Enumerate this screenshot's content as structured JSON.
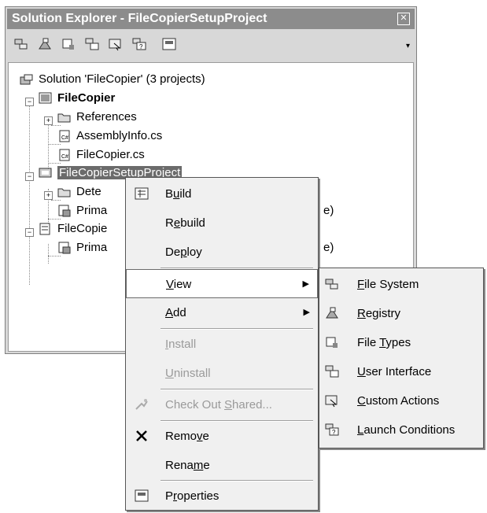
{
  "window": {
    "title": "Solution Explorer - FileCopierSetupProject",
    "close_glyph": "✕"
  },
  "toolbar": {
    "buttons": [
      "file-system-icon",
      "registry-icon",
      "file-types-icon",
      "user-interface-icon",
      "custom-actions-icon",
      "launch-conditions-icon",
      "properties-icon"
    ],
    "dropdown_glyph": "▾"
  },
  "tree": {
    "solution": "Solution 'FileCopier' (3 projects)",
    "project1": "FileCopier",
    "references": "References",
    "assemblyinfo": "AssemblyInfo.cs",
    "filecopier_cs": "FileCopier.cs",
    "setup_project": "FileCopierSetupProject",
    "detected_partial": "Dete",
    "primary1_partial": "Prima",
    "primary1_tail": "e)",
    "project3_partial": "FileCopie",
    "primary2_partial": "Prima",
    "primary2_tail": "e)"
  },
  "context_menu": {
    "items": [
      {
        "pre": "B",
        "mn": "u",
        "post": "ild"
      },
      {
        "pre": "R",
        "mn": "e",
        "post": "build"
      },
      {
        "pre": "De",
        "mn": "p",
        "post": "loy"
      },
      {
        "pre": "",
        "mn": "V",
        "post": "iew"
      },
      {
        "pre": "",
        "mn": "A",
        "post": "dd"
      },
      {
        "pre": "",
        "mn": "I",
        "post": "nstall"
      },
      {
        "pre": "",
        "mn": "U",
        "post": "ninstall"
      },
      {
        "pre": "Check Out ",
        "mn": "S",
        "post": "hared..."
      },
      {
        "pre": "Remo",
        "mn": "v",
        "post": "e"
      },
      {
        "pre": "Rena",
        "mn": "m",
        "post": "e"
      },
      {
        "pre": "P",
        "mn": "r",
        "post": "operties"
      }
    ],
    "submenu_arrow": "▶"
  },
  "view_submenu": {
    "items": [
      {
        "pre": "",
        "mn": "F",
        "post": "ile System"
      },
      {
        "pre": "",
        "mn": "R",
        "post": "egistry"
      },
      {
        "pre": "File ",
        "mn": "T",
        "post": "ypes"
      },
      {
        "pre": "",
        "mn": "U",
        "post": "ser Interface"
      },
      {
        "pre": "",
        "mn": "C",
        "post": "ustom Actions"
      },
      {
        "pre": "",
        "mn": "L",
        "post": "aunch Conditions"
      }
    ]
  },
  "colors": {
    "title_bar": "#8c8c8c",
    "selection": "#6b6b6b",
    "menu_bg": "#f0f0f0",
    "disabled_text": "#9a9a9a"
  }
}
